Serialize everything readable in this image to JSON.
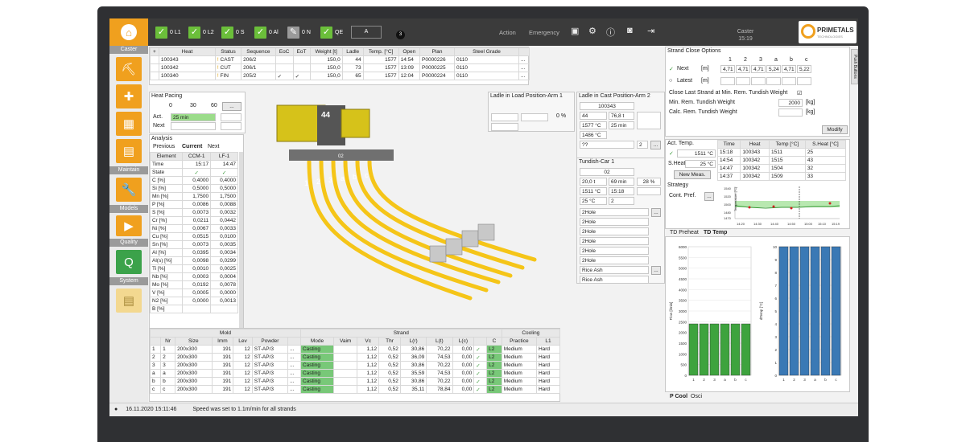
{
  "topbar": {
    "checks": [
      {
        "label": "0 L1"
      },
      {
        "label": "0 L2"
      },
      {
        "label": "0 S"
      },
      {
        "label": "0 Al"
      },
      {
        "label": "0 N"
      },
      {
        "label": "QE"
      }
    ],
    "qe_value": "A",
    "badge": "3",
    "action": "Action",
    "emergency": "Emergency",
    "caster_title": "Caster",
    "time": "15:19",
    "logo_name": "PRIMETALS",
    "logo_sub": "TECHNOLOGIES"
  },
  "sidebar": {
    "caster": "Caster",
    "maintain": "Maintain",
    "models": "Models",
    "quality": "Quality",
    "system": "System"
  },
  "heats": {
    "headers": [
      "+",
      "Heat",
      "",
      "Status",
      "Sequence",
      "EoC",
      "EoT",
      "Weight [t]",
      "Ladle",
      "Temp. [°C]",
      "Open",
      "Plan",
      "Steel Grade",
      ""
    ],
    "rows": [
      [
        "343",
        "100343",
        "!",
        "CAST",
        "206/2",
        "",
        "",
        "150,0",
        "44",
        "1577",
        "14:54",
        "P0000226",
        "0110",
        "..."
      ],
      [
        "342",
        "100342",
        "!",
        "CUT",
        "206/1",
        "",
        "",
        "150,0",
        "73",
        "1577",
        "13:09",
        "P0000225",
        "0110",
        "..."
      ],
      [
        "341",
        "100340",
        "!",
        "FIN",
        "205/2",
        "✓",
        "✓",
        "150,0",
        "65",
        "1577",
        "12:04",
        "P0000224",
        "0110",
        "..."
      ]
    ]
  },
  "heat_pacing": {
    "title": "Heat Pacing",
    "scale": [
      "0",
      "30",
      "60"
    ],
    "act_label": "Act.",
    "act_value": "25 min",
    "next_label": "Next"
  },
  "analysis": {
    "title": "Analysis",
    "tabs": [
      "Previous",
      "Current",
      "Next"
    ],
    "headers": [
      "Element",
      "CCM-1",
      "LF-1"
    ],
    "rows": [
      [
        "Time",
        "15:17",
        "14:47"
      ],
      [
        "State",
        "✓",
        "✓"
      ],
      [
        "C [%]",
        "0,4000",
        "0,4000"
      ],
      [
        "Si [%]",
        "0,5000",
        "0,5000"
      ],
      [
        "Mn [%]",
        "1,7500",
        "1,7500"
      ],
      [
        "P [%]",
        "0,0086",
        "0,0088"
      ],
      [
        "S [%]",
        "0,0073",
        "0,0032"
      ],
      [
        "Cr [%]",
        "0,0211",
        "0,0442"
      ],
      [
        "Ni [%]",
        "0,0067",
        "0,0033"
      ],
      [
        "Cu [%]",
        "0,0515",
        "0,0100"
      ],
      [
        "Sn [%]",
        "0,0073",
        "0,0035"
      ],
      [
        "Al [%]",
        "0,0395",
        "0,0034"
      ],
      [
        "Al(s) [%]",
        "0,0098",
        "0,0299"
      ],
      [
        "Ti [%]",
        "0,0010",
        "0,0025"
      ],
      [
        "Nb [%]",
        "0,0003",
        "0,0004"
      ],
      [
        "Mo [%]",
        "0,0192",
        "0,0078"
      ],
      [
        "V [%]",
        "0,0005",
        "0,0000"
      ],
      [
        "N2 [%]",
        "0,0000",
        "0,0013"
      ],
      [
        "B [%]",
        "",
        ""
      ]
    ]
  },
  "caster3d": {
    "ladle": "44",
    "tundish": "02",
    "strands": [
      "1",
      "2",
      "3",
      "a",
      "b",
      "c"
    ]
  },
  "ladle_load": {
    "title": "Ladle in Load Position-Arm 1",
    "pct": "0 %"
  },
  "ladle_cast": {
    "title": "Ladle in Cast Position-Arm 2",
    "heat": "100343",
    "ladle": "44",
    "weight": "76,8 t",
    "temp1": "1577 °C",
    "time": "25 min",
    "temp2": "1486 °C",
    "pct": "51 %",
    "unk": "??",
    "num": "2"
  },
  "tundish": {
    "title": "Tundish-Car 1",
    "id": "02",
    "weight": "20,0 t",
    "time": "69 min",
    "pct": "28 %",
    "temp": "1511 °C",
    "clock": "15:18",
    "temp2": "25 °C",
    "num": "2",
    "items": [
      "2Hole",
      "2Hole",
      "2Hole",
      "2Hole",
      "2Hole",
      "2Hole",
      "Rice Ash",
      "Rice Ash"
    ]
  },
  "strand_close": {
    "title": "Strand Close Options",
    "cols": [
      "1",
      "2",
      "3",
      "a",
      "b",
      "c"
    ],
    "next_label": "Next",
    "unit": "[m]",
    "next_vals": [
      "4,71",
      "4,71",
      "4,71",
      "5,24",
      "4,71",
      "5,22"
    ],
    "latest_label": "Latest",
    "close_label": "Close Last Strand at Min. Rem. Tundish Weight",
    "min_label": "Min. Rem. Tundish Weight",
    "min_value": "2000",
    "min_unit": "[kg]",
    "calc_label": "Calc. Rem. Tundish Weight",
    "calc_unit": "[kg]",
    "modify": "Modify",
    "push_tab": "Push Buttons"
  },
  "act_temp": {
    "title": "Act. Temp.",
    "value": "1511 °C",
    "sheat_label": "S.Heat",
    "sheat_value": "25 °C",
    "new_meas": "New Meas.",
    "strategy": "Strategy",
    "cont_pref": "Cont. Pref.",
    "headers": [
      "Time",
      "Heat",
      "Temp [°C]",
      "S.Heat [°C]"
    ],
    "rows": [
      [
        "15:18",
        "100343",
        "1511",
        "25"
      ],
      [
        "14:54",
        "100342",
        "1515",
        "43"
      ],
      [
        "14:47",
        "100342",
        "1504",
        "32"
      ],
      [
        "14:37",
        "100342",
        "1509",
        "33"
      ]
    ]
  },
  "temp_chart": {
    "ylabel": "Temperature [°C]",
    "yticks": [
      "1540",
      "1520",
      "1500",
      "1480",
      "1470"
    ],
    "xticks": [
      "14:20",
      "14:30",
      "14:40",
      "14:50",
      "15:00",
      "15:10",
      "15:19"
    ]
  },
  "td_tabs": [
    "TD Preheat",
    "TD Temp"
  ],
  "chart_data": [
    {
      "type": "bar",
      "ylabel": "Flow [l/min]",
      "ylim": [
        0,
        6000
      ],
      "yticks": [
        "6000",
        "5500",
        "5000",
        "4500",
        "4000",
        "3500",
        "3000",
        "2500",
        "2000",
        "1500",
        "1000",
        "500",
        "0"
      ],
      "categories": [
        "1",
        "2",
        "3",
        "a",
        "b",
        "c"
      ],
      "values": [
        2400,
        2400,
        2400,
        2400,
        2400,
        2400
      ],
      "color": "#3ea33e"
    },
    {
      "type": "bar",
      "ylabel": "dTemp [°C]",
      "ylim": [
        0,
        10
      ],
      "yticks": [
        "10",
        "9",
        "8",
        "7",
        "6",
        "5",
        "4",
        "3",
        "2",
        "1",
        "0"
      ],
      "categories": [
        "1",
        "2",
        "3",
        "a",
        "b",
        "c"
      ],
      "values": [
        10,
        10,
        10,
        10,
        10,
        10
      ],
      "color": "#3a79b5"
    }
  ],
  "bottom_tabs": [
    "P Cool",
    "Osci"
  ],
  "strand_table": {
    "groups": [
      "Mold",
      "Strand",
      "Cooling"
    ],
    "headers": [
      "Nr",
      "Size",
      "Imm",
      "Lev",
      "Powder",
      "",
      "Mode",
      "Vaim",
      "Vc",
      "Thr",
      "L(r)",
      "L(t)",
      "L(c)",
      "",
      "C",
      "Practice",
      "L1"
    ],
    "rows": [
      [
        "1",
        "1",
        "200x300",
        "191",
        "12",
        "ST-AP/3",
        "...",
        "Casting",
        "",
        "1,12",
        "0,52",
        "30,86",
        "70,22",
        "0,00",
        "✓",
        "L2",
        "Medium",
        "Hard"
      ],
      [
        "2",
        "2",
        "200x300",
        "191",
        "12",
        "ST-AP/3",
        "...",
        "Casting",
        "",
        "1,12",
        "0,52",
        "36,09",
        "74,53",
        "0,00",
        "✓",
        "L2",
        "Medium",
        "Hard"
      ],
      [
        "3",
        "3",
        "200x300",
        "191",
        "12",
        "ST-AP/3",
        "...",
        "Casting",
        "",
        "1,12",
        "0,52",
        "30,86",
        "70,22",
        "0,00",
        "✓",
        "L2",
        "Medium",
        "Hard"
      ],
      [
        "a",
        "a",
        "200x300",
        "191",
        "12",
        "ST-AP/3",
        "...",
        "Casting",
        "",
        "1,12",
        "0,52",
        "35,59",
        "74,53",
        "0,00",
        "✓",
        "L2",
        "Medium",
        "Hard"
      ],
      [
        "b",
        "b",
        "200x300",
        "191",
        "12",
        "ST-AP/3",
        "...",
        "Casting",
        "",
        "1,12",
        "0,52",
        "30,86",
        "70,22",
        "0,00",
        "✓",
        "L2",
        "Medium",
        "Hard"
      ],
      [
        "c",
        "c",
        "200x300",
        "191",
        "12",
        "ST-AP/3",
        "...",
        "Casting",
        "",
        "1,12",
        "0,52",
        "35,11",
        "78,84",
        "0,00",
        "✓",
        "L2",
        "Medium",
        "Hard"
      ]
    ]
  },
  "status": {
    "timestamp": "16.11.2020 15:11:46",
    "message": "Speed was set to 1.1m/min for all strands"
  }
}
